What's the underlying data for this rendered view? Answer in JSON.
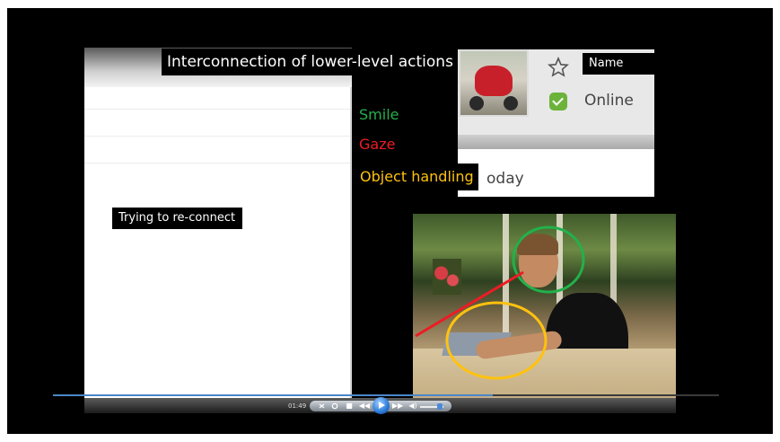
{
  "slide": {
    "title": "Interconnection of lower-level actions",
    "reconnect_label": "Trying to re-connect"
  },
  "legend": {
    "smile": "Smile",
    "gaze": "Gaze",
    "object_handling": "Object handling"
  },
  "chat_snippet": {
    "name_label": "Name",
    "status_text": "Online",
    "today_fragment": "oday"
  },
  "player": {
    "time": "01:49",
    "progress_fraction": 0.66,
    "volume_fraction": 0.85,
    "stop_icon": "■",
    "prev_icon": "◀◀",
    "next_icon": "▶▶",
    "volume_icon": "◀)"
  },
  "colors": {
    "smile": "#22b14c",
    "gaze": "#ed1c24",
    "object_handling": "#ffc20e",
    "accent": "#4b86c8"
  }
}
